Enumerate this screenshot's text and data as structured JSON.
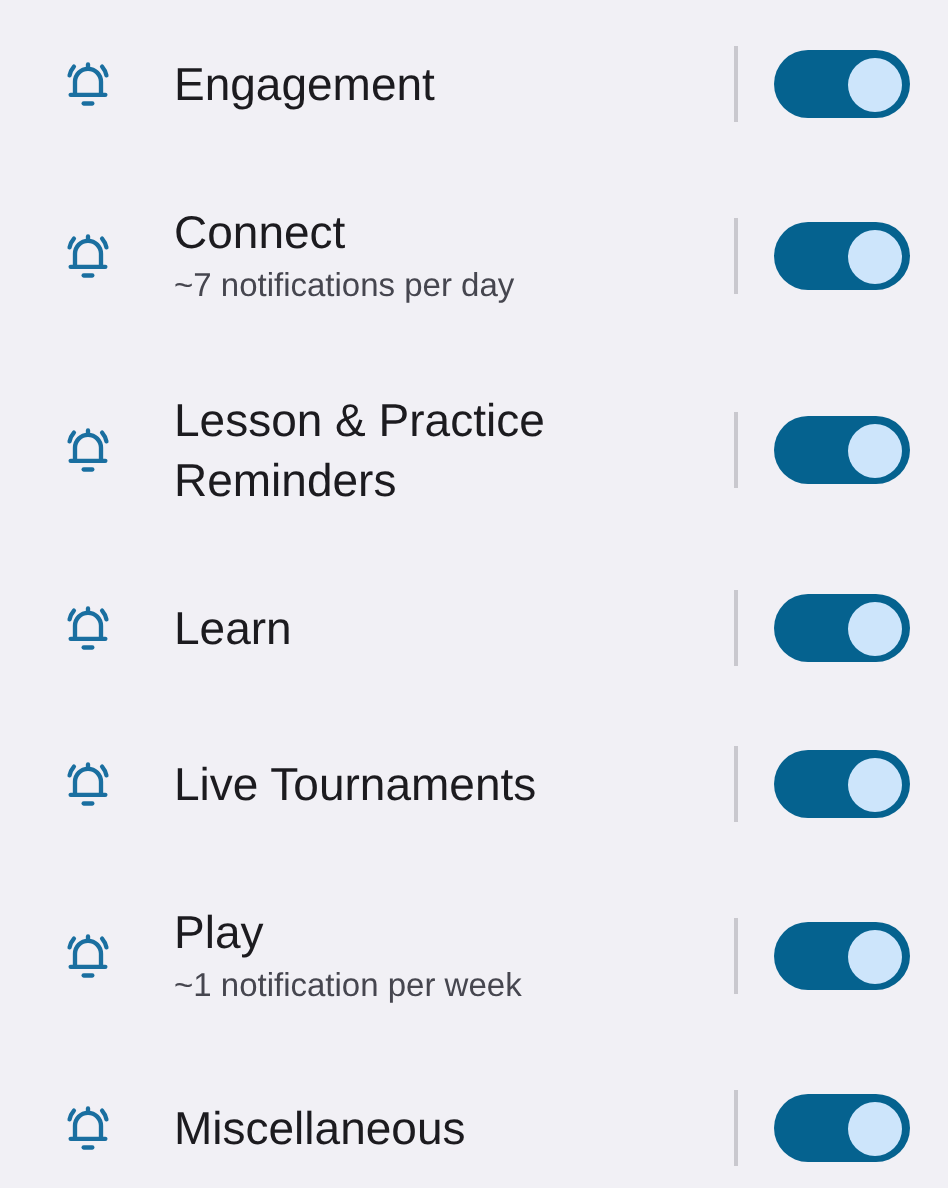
{
  "settings": [
    {
      "title": "Engagement",
      "on": true
    },
    {
      "title": "Connect",
      "subtitle": "~7 notifications per day",
      "on": true
    },
    {
      "title": "Lesson & Practice Reminders",
      "on": true
    },
    {
      "title": "Learn",
      "on": true
    },
    {
      "title": "Live Tournaments",
      "on": true
    },
    {
      "title": "Play",
      "subtitle": "~1 notification per week",
      "on": true
    },
    {
      "title": "Miscellaneous",
      "on": true
    }
  ]
}
